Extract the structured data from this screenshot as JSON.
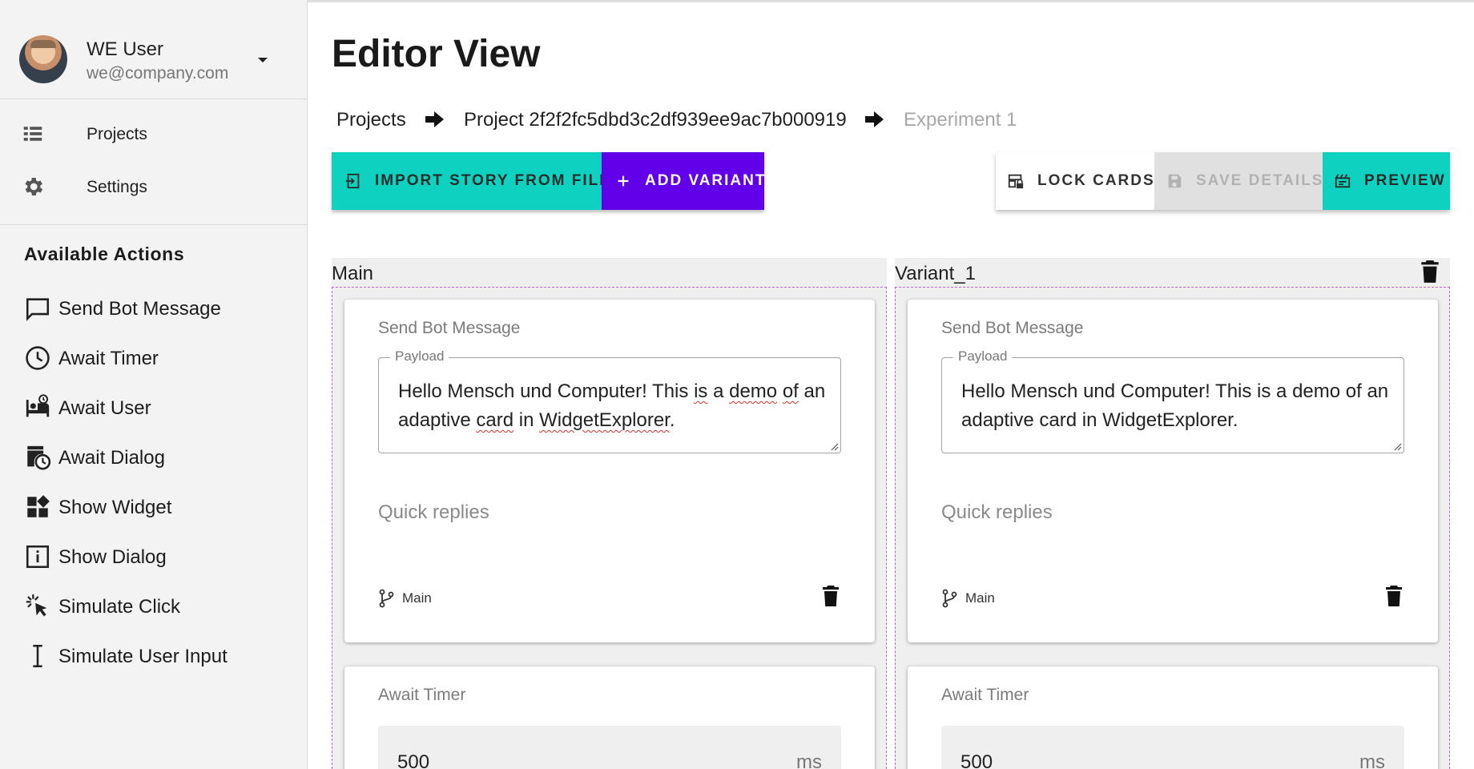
{
  "user": {
    "name": "WE User",
    "email": "we@company.com"
  },
  "nav": [
    {
      "label": "Projects",
      "icon": "list-icon"
    },
    {
      "label": "Settings",
      "icon": "gear-icon"
    }
  ],
  "actions_title": "Available Actions",
  "actions": [
    {
      "label": "Send Bot Message",
      "icon": "chat-bubble-icon"
    },
    {
      "label": "Await Timer",
      "icon": "clock-icon"
    },
    {
      "label": "Await User",
      "icon": "hotel-bed-icon"
    },
    {
      "label": "Await Dialog",
      "icon": "pending-actions-icon"
    },
    {
      "label": "Show Widget",
      "icon": "widgets-icon"
    },
    {
      "label": "Show Dialog",
      "icon": "info-box-icon"
    },
    {
      "label": "Simulate Click",
      "icon": "cursor-click-icon"
    },
    {
      "label": "Simulate User Input",
      "icon": "text-cursor-icon"
    }
  ],
  "page_title": "Editor View",
  "breadcrumb": {
    "projects": "Projects",
    "project": "Project 2f2f2fc5dbd3c2df939ee9ac7b000919",
    "experiment": "Experiment 1"
  },
  "toolbar": {
    "import": "IMPORT STORY FROM FILE",
    "add_variant": "ADD VARIANT",
    "lock_cards": "LOCK CARDS",
    "save_details": "SAVE DETAILS",
    "preview": "PREVIEW"
  },
  "colors": {
    "teal": "#0fd1c0",
    "purple": "#6200ea",
    "disabled": "#e0e0e0"
  },
  "columns": [
    {
      "title": "Main",
      "cards": {
        "message_title": "Send Bot Message",
        "payload_label": "Payload",
        "payload_text": "Hello Mensch und Computer! This is a demo of an adaptive card in WidgetExplorer.",
        "quick_replies": "Quick replies",
        "branch": "Main",
        "timer_title": "Await Timer",
        "timer_value": "500",
        "timer_unit": "ms"
      }
    },
    {
      "title": "Variant_1",
      "cards": {
        "message_title": "Send Bot Message",
        "payload_label": "Payload",
        "payload_text": "Hello Mensch und Computer! This is a demo of an adaptive card in WidgetExplorer.",
        "quick_replies": "Quick replies",
        "branch": "Main",
        "timer_title": "Await Timer",
        "timer_value": "500",
        "timer_unit": "ms"
      }
    }
  ]
}
